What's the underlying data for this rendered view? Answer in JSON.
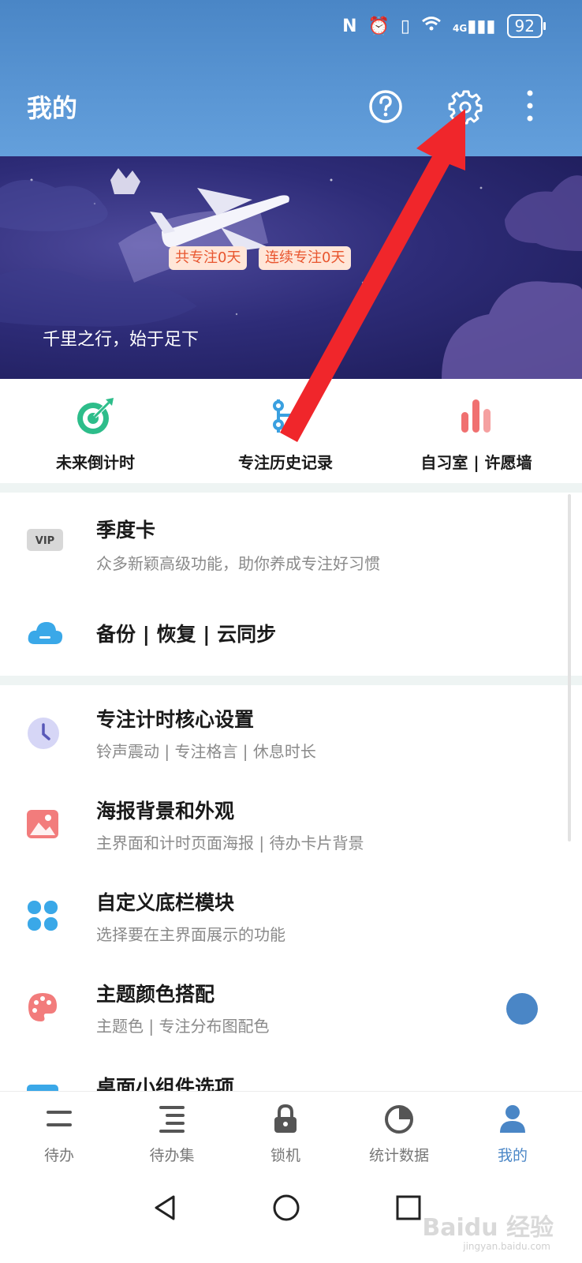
{
  "status_bar": {
    "icons": [
      "nfc-icon",
      "alarm-icon",
      "vibrate-icon",
      "wifi-icon",
      "signal-4g-icon"
    ],
    "network": "4G",
    "battery": "92"
  },
  "header": {
    "title": "我的",
    "background_color": "#4a86c6",
    "icons": [
      "help-icon",
      "settings-icon",
      "more-icon"
    ]
  },
  "banner": {
    "tag_total": "共专注0天",
    "tag_streak": "连续专注0天",
    "motto": "千里之行，始于足下"
  },
  "quick_actions": [
    {
      "label": "未来倒计时",
      "icon": "target-icon",
      "color": "#2dbd8a"
    },
    {
      "label": "专注历史记录",
      "icon": "history-icon",
      "color": "#3aa0e0"
    },
    {
      "label": "自习室 | 许愿墙",
      "icon": "bars-icon",
      "color": "#f07070"
    }
  ],
  "section1": [
    {
      "title": "季度卡",
      "subtitle": "众多新颖高级功能，助你养成专注好习惯",
      "icon": "vip-icon",
      "icon_text": "VIP"
    },
    {
      "title": "备份 | 恢复 | 云同步",
      "icon": "cloud-icon"
    }
  ],
  "section2": [
    {
      "title": "专注计时核心设置",
      "subtitle": "铃声震动 | 专注格言 | 休息时长",
      "icon": "clock-icon"
    },
    {
      "title": "海报背景和外观",
      "subtitle": "主界面和计时页面海报 | 待办卡片背景",
      "icon": "image-icon"
    },
    {
      "title": "自定义底栏模块",
      "subtitle": "选择要在主界面展示的功能",
      "icon": "clover-icon"
    },
    {
      "title": "主题颜色搭配",
      "subtitle": "主题色 | 专注分布图配色",
      "icon": "palette-icon",
      "theme_color": "#4a86c6"
    },
    {
      "title": "桌面小组件选项",
      "icon": "widget-icon"
    }
  ],
  "bottom_nav": [
    {
      "label": "待办",
      "icon": "todo-icon",
      "active": false
    },
    {
      "label": "待办集",
      "icon": "todo-set-icon",
      "active": false
    },
    {
      "label": "锁机",
      "icon": "lock-icon",
      "active": false
    },
    {
      "label": "统计数据",
      "icon": "stats-icon",
      "active": false
    },
    {
      "label": "我的",
      "icon": "profile-icon",
      "active": true
    }
  ],
  "accent_color": "#4a86c6",
  "watermark": {
    "text": "Baidu 经验",
    "sub": "jingyan.baidu.com"
  }
}
